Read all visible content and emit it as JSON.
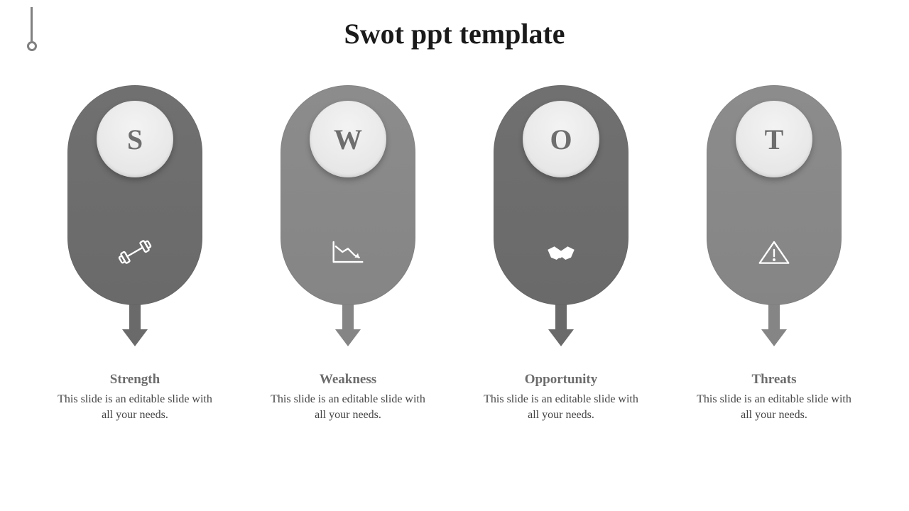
{
  "title": "Swot ppt template",
  "items": [
    {
      "letter": "S",
      "tone": "dark",
      "icon": "dumbbell-icon",
      "heading": "Strength",
      "desc": "This slide is an editable slide with all your needs."
    },
    {
      "letter": "W",
      "tone": "light",
      "icon": "downtrend-icon",
      "heading": "Weakness",
      "desc": "This slide is an editable slide with all your needs."
    },
    {
      "letter": "O",
      "tone": "dark",
      "icon": "handshake-icon",
      "heading": "Opportunity",
      "desc": "This slide is an editable slide with all your needs."
    },
    {
      "letter": "T",
      "tone": "light",
      "icon": "warning-icon",
      "heading": "Threats",
      "desc": "This slide is an editable slide with all your needs."
    }
  ]
}
